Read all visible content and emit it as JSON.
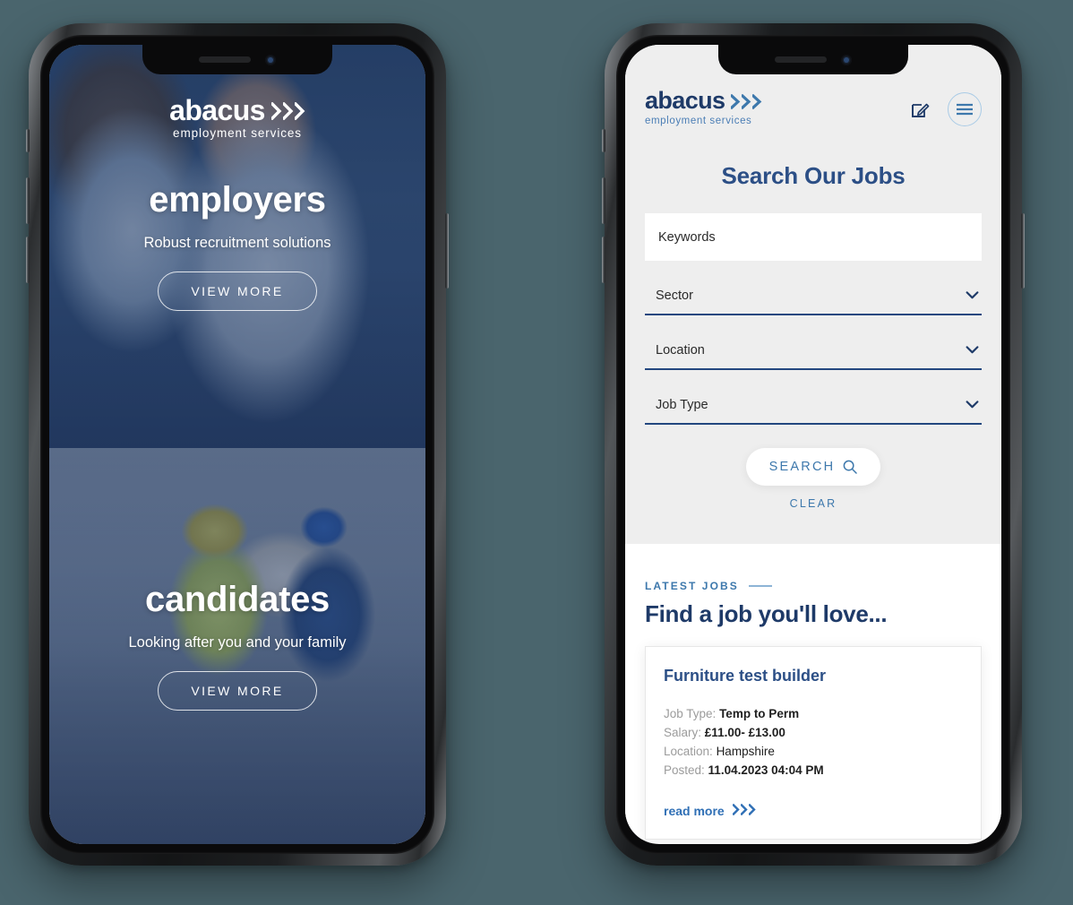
{
  "background_color": "#4a656d",
  "brand": {
    "name": "abacus",
    "tagline": "employment services",
    "navy": "#1e3a68",
    "blue": "#3d78ac",
    "light_blue": "#4a7db5"
  },
  "left_phone": {
    "logo": {
      "name": "abacus",
      "tagline": "employment services"
    },
    "panels": [
      {
        "title": "employers",
        "subtitle": "Robust recruitment solutions",
        "button_label": "VIEW MORE"
      },
      {
        "title": "candidates",
        "subtitle": "Looking after you and your family",
        "button_label": "VIEW MORE"
      }
    ]
  },
  "right_phone": {
    "header": {
      "logo": {
        "name": "abacus",
        "tagline": "employment services"
      },
      "edit_icon": "edit-square-icon",
      "menu_icon": "hamburger-menu-icon"
    },
    "search": {
      "heading": "Search Our Jobs",
      "keywords_placeholder": "Keywords",
      "keywords_value": "",
      "selects": [
        {
          "label": "Sector",
          "value": "Sector"
        },
        {
          "label": "Location",
          "value": "Location"
        },
        {
          "label": "Job Type",
          "value": "Job Type"
        }
      ],
      "search_label": "SEARCH",
      "search_icon": "magnifier-icon",
      "clear_label": "CLEAR"
    },
    "jobs": {
      "eyebrow": "LATEST JOBS",
      "heading": "Find a job you'll love...",
      "card": {
        "title": "Furniture test builder",
        "job_type_label": "Job Type:",
        "job_type_value": "Temp to Perm",
        "salary_label": "Salary:",
        "salary_value": "£11.00- £13.00",
        "location_label": "Location:",
        "location_value": "Hampshire",
        "posted_label": "Posted:",
        "posted_value": "11.04.2023 04:04 PM",
        "read_more_label": "read more"
      }
    }
  }
}
